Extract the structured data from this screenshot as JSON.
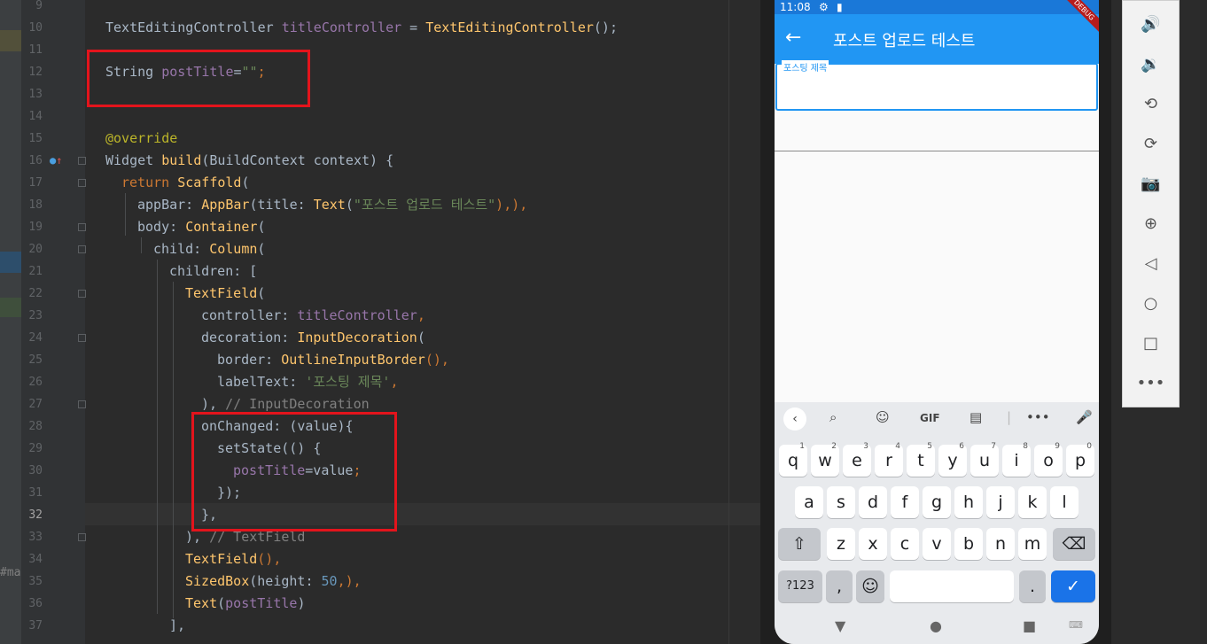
{
  "editor": {
    "line_numbers": [
      "9",
      "10",
      "11",
      "12",
      "13",
      "14",
      "15",
      "16",
      "17",
      "18",
      "19",
      "20",
      "21",
      "22",
      "23",
      "24",
      "25",
      "26",
      "27",
      "28",
      "29",
      "30",
      "31",
      "32",
      "33",
      "34",
      "35",
      "36",
      "37"
    ],
    "lines": {
      "l10": {
        "a": "TextEditingController ",
        "b": "titleController",
        "c": " = ",
        "d": "TextEditingController",
        "e": "();"
      },
      "l12": {
        "a": "String ",
        "b": "postTitle",
        "c": "=",
        "d": "\"\"",
        "e": ";"
      },
      "l15": {
        "a": "@override"
      },
      "l16": {
        "a": "Widget ",
        "b": "build",
        "c": "(BuildContext context) {"
      },
      "l17": {
        "a": "return ",
        "b": "Scaffold",
        "c": "("
      },
      "l18": {
        "a": "appBar: ",
        "b": "AppBar",
        "c": "(title: ",
        "d": "Text",
        "e": "(",
        "f": "\"포스트 업로드 테스트\"",
        "g": "),),"
      },
      "l19": {
        "a": "body: ",
        "b": "Container",
        "c": "("
      },
      "l20": {
        "a": "child: ",
        "b": "Column",
        "c": "("
      },
      "l21": {
        "a": "children: ["
      },
      "l22": {
        "a": "TextField",
        "b": "("
      },
      "l23": {
        "a": "controller: ",
        "b": "titleController",
        "c": ","
      },
      "l24": {
        "a": "decoration: ",
        "b": "InputDecoration",
        "c": "("
      },
      "l25": {
        "a": "border: ",
        "b": "OutlineInputBorder",
        "c": "(),"
      },
      "l26": {
        "a": "labelText: ",
        "b": "'포스팅 제목'",
        "c": ","
      },
      "l27": {
        "a": "), ",
        "b": "// InputDecoration"
      },
      "l28": {
        "a": "onChanged: (value){"
      },
      "l29": {
        "a": "setState(() {"
      },
      "l30": {
        "a": "postTitle",
        "b": "=value",
        "c": ";"
      },
      "l31": {
        "a": "});"
      },
      "l32": {
        "a": "},"
      },
      "l33": {
        "a": "), ",
        "b": "// TextField"
      },
      "l34": {
        "a": "TextField",
        "b": "(),"
      },
      "l35": {
        "a": "SizedBox",
        "b": "(height: ",
        "c": "50",
        "d": ",),"
      },
      "l36": {
        "a": "Text",
        "b": "(",
        "c": "postTitle",
        "d": ")"
      },
      "l37": {
        "a": "],"
      }
    },
    "side_fragment": "#ma"
  },
  "emulator": {
    "status_time": "11:08",
    "debug_banner": "DEBUG",
    "app_title": "포스트 업로드 테스트",
    "field_label": "포스팅 제목",
    "suggestions": {
      "gif": "GIF"
    },
    "rows": {
      "r1": [
        [
          "q",
          "1"
        ],
        [
          "w",
          "2"
        ],
        [
          "e",
          "3"
        ],
        [
          "r",
          "4"
        ],
        [
          "t",
          "5"
        ],
        [
          "y",
          "6"
        ],
        [
          "u",
          "7"
        ],
        [
          "i",
          "8"
        ],
        [
          "o",
          "9"
        ],
        [
          "p",
          "0"
        ]
      ],
      "r2": [
        "a",
        "s",
        "d",
        "f",
        "g",
        "h",
        "j",
        "k",
        "l"
      ],
      "r3": [
        "z",
        "x",
        "c",
        "v",
        "b",
        "n",
        "m"
      ]
    },
    "keys": {
      "sym": "?123",
      "comma": ",",
      "period": "."
    },
    "colors": {
      "appbar": "#2196f3",
      "accent": "#1a73e8",
      "highlight": "#e3141c"
    }
  }
}
